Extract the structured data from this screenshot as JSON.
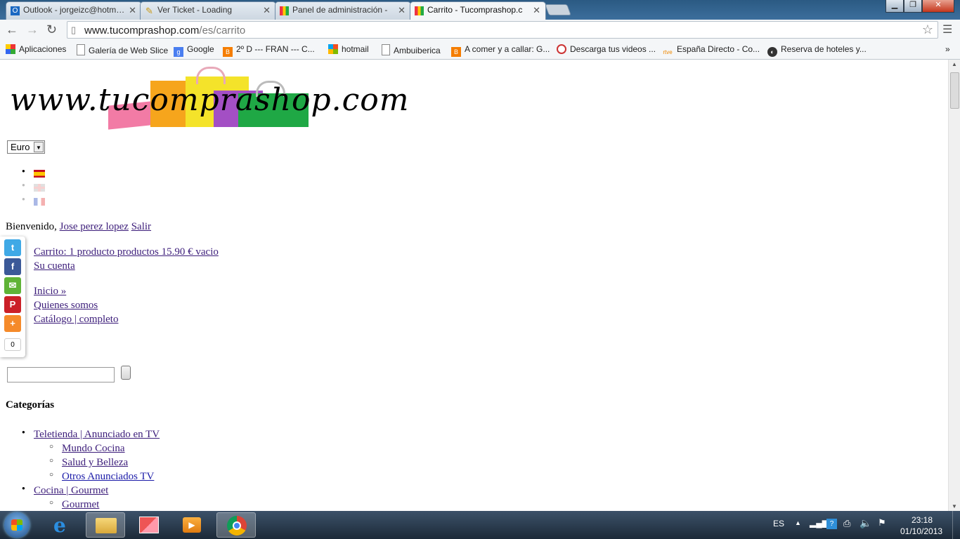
{
  "browser": {
    "tabs": [
      {
        "label": "Outlook - jorgeizc@hotm…",
        "icon": "outlook-icon"
      },
      {
        "label": "Ver Ticket - Loading",
        "icon": "pencil-icon"
      },
      {
        "label": "Panel de administración -",
        "icon": "shop-icon"
      },
      {
        "label": "Carrito - Tucomprashop.c",
        "icon": "shop-icon"
      }
    ],
    "url_domain": "www.tucomprashop.com",
    "url_path": "/es/carrito",
    "bookmarks": [
      "Aplicaciones",
      "Galería de Web Slice",
      "Google",
      "2º D --- FRAN --- C...",
      "hotmail",
      "Ambuiberica",
      "A comer y a callar: G...",
      "Descarga tus videos ...",
      "España Directo - Co...",
      "Reserva de hoteles y..."
    ],
    "bookmarks_more": "»"
  },
  "page": {
    "logo_text": "www.tucomprashop.com",
    "currency": "Euro",
    "welcome_text": "Bienvenido,",
    "user_name": "Jose perez lopez",
    "logout": "Salir",
    "cart_link": "Carrito: 1 producto productos 15.90 € vacio",
    "account_link": "Su cuenta",
    "nav_links": [
      "Inicio »",
      "Quienes somos",
      "Catálogo | completo"
    ],
    "categories_title": "Categorías",
    "categories": [
      {
        "label": "Teletienda | Anunciado en TV",
        "children": [
          "Mundo Cocina",
          "Salud y Belleza",
          "Otros Anunciados TV"
        ]
      },
      {
        "label": "Cocina | Gourmet",
        "children": [
          "Gourmet"
        ]
      }
    ],
    "share_count": "0"
  },
  "taskbar": {
    "lang": "ES",
    "time": "23:18",
    "date": "01/10/2013"
  }
}
